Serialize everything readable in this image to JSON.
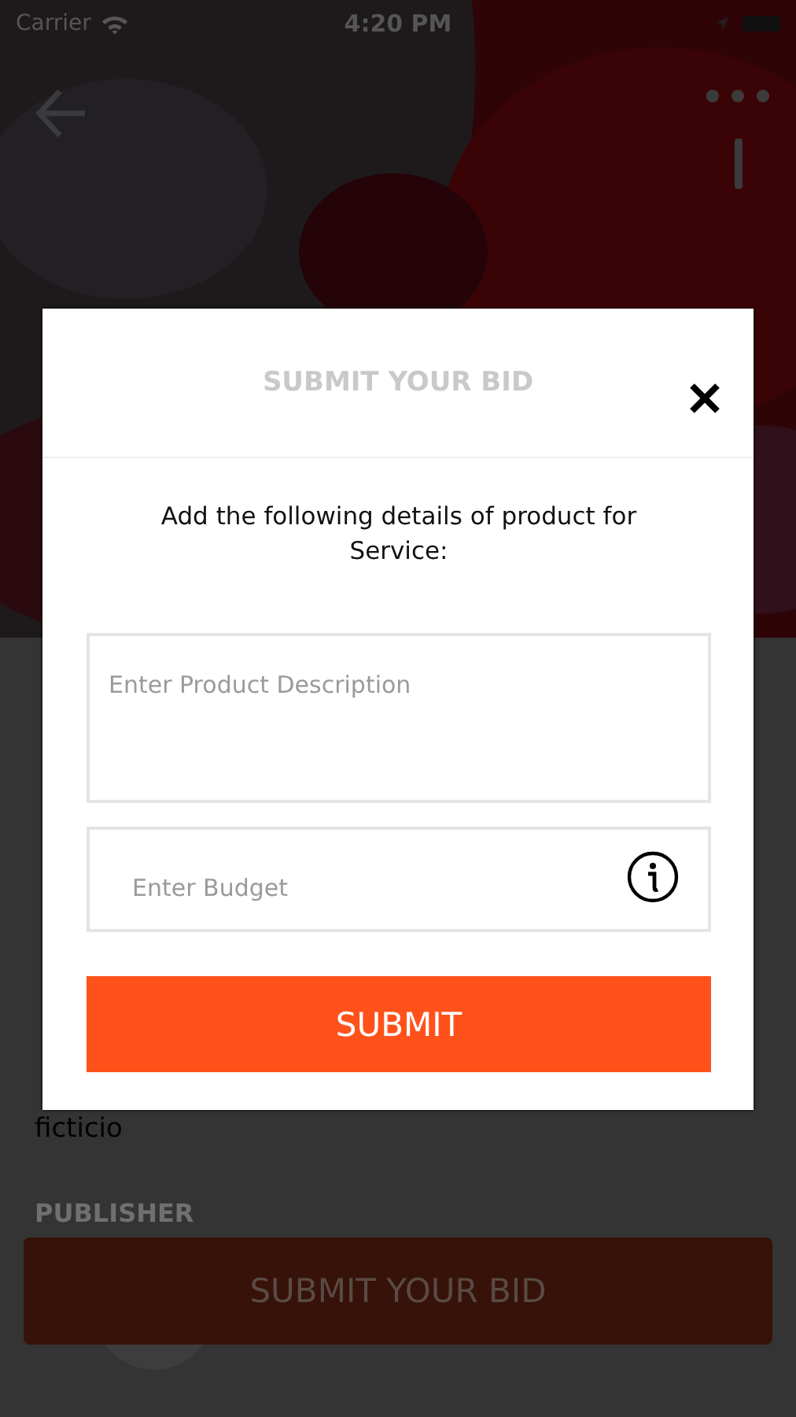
{
  "status_bar": {
    "carrier": "Carrier",
    "time": "4:20 PM"
  },
  "background": {
    "detail_text": "ficticio",
    "section_label": "PUBLISHER",
    "bid_button": "SUBMIT YOUR BID"
  },
  "modal": {
    "title": "SUBMIT YOUR BID",
    "instructions": "Add the following details of product for Service:",
    "fields": [
      {
        "kind": "textarea",
        "placeholder": "Enter Product Description"
      },
      {
        "kind": "input",
        "placeholder": "Enter Budget",
        "info": true
      }
    ],
    "submit_label": "SUBMIT"
  }
}
